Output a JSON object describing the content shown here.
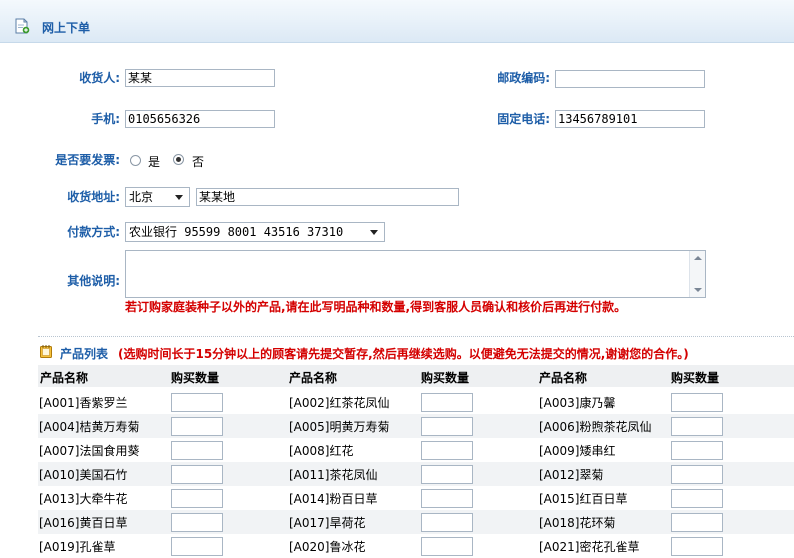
{
  "header": {
    "title": "网上下单"
  },
  "form": {
    "receiver": {
      "label": "收货人:",
      "value": "某某"
    },
    "postcode": {
      "label": "邮政编码:",
      "value": ""
    },
    "mobile": {
      "label": "手机:",
      "value": "0105656326"
    },
    "phone": {
      "label": "固定电话:",
      "value": "13456789101"
    },
    "invoice": {
      "label": "是否要发票:",
      "yes": "是",
      "no": "否",
      "selected": "否"
    },
    "address": {
      "label": "收货地址:",
      "city": "北京",
      "detail": "某某地"
    },
    "payment": {
      "label": "付款方式:",
      "value": "农业银行 95599 8001 43516 37310"
    },
    "remark": {
      "label": "其他说明:",
      "value": ""
    },
    "warning": "若订购家庭装种子以外的产品,请在此写明品种和数量,得到客服人员确认和核价后再进行付款。"
  },
  "product_list": {
    "title": "产品列表",
    "note": "(选购时间长于15分钟以上的顾客请先提交暂存,然后再继续选购。以便避免无法提交的情况,谢谢您的合作。)",
    "col_name": "产品名称",
    "col_qty": "购买数量",
    "items": [
      [
        "[A001]香紫罗兰",
        "[A002]红茶花凤仙",
        "[A003]康乃馨"
      ],
      [
        "[A004]桔黄万寿菊",
        "[A005]明黄万寿菊",
        "[A006]粉煦茶花凤仙"
      ],
      [
        "[A007]法国食用葵",
        "[A008]红花",
        "[A009]矮串红"
      ],
      [
        "[A010]美国石竹",
        "[A011]茶花凤仙",
        "[A012]翠菊"
      ],
      [
        "[A013]大牵牛花",
        "[A014]粉百日草",
        "[A015]红百日草"
      ],
      [
        "[A016]黄百日草",
        "[A017]旱荷花",
        "[A018]花环菊"
      ],
      [
        "[A019]孔雀草",
        "[A020]鲁冰花",
        "[A021]密花孔雀草"
      ]
    ]
  }
}
